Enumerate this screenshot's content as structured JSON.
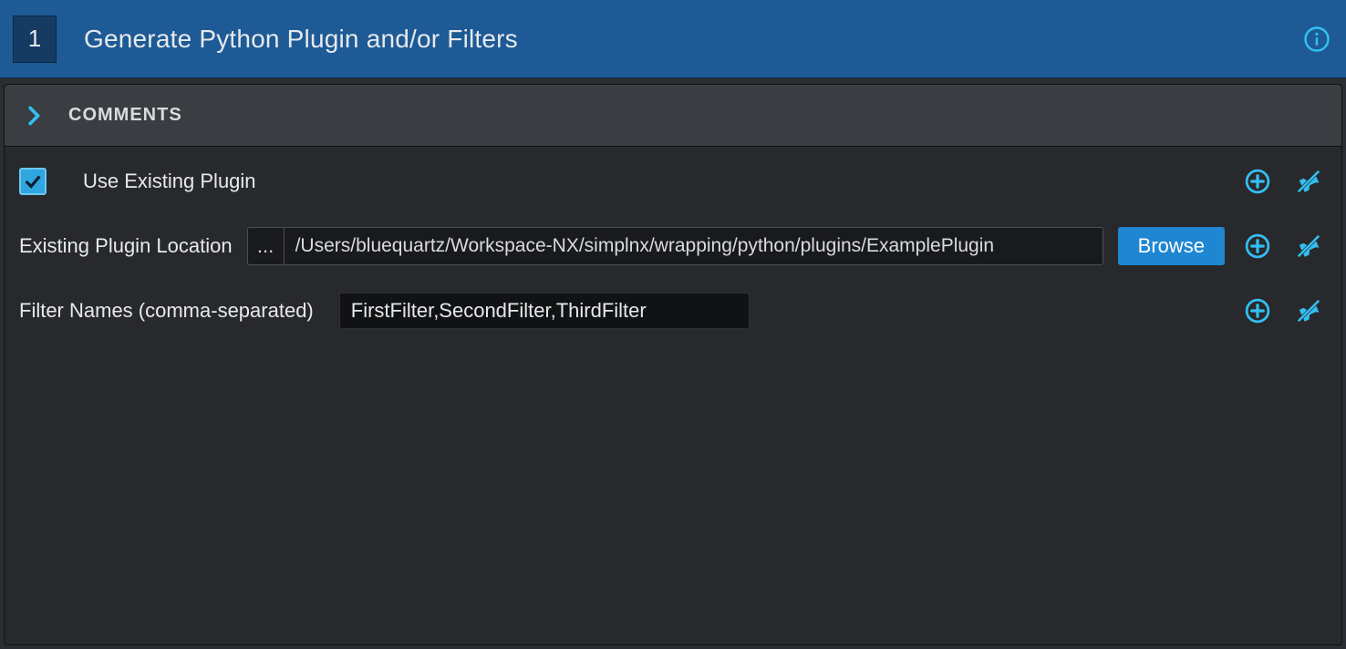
{
  "header": {
    "step_number": "1",
    "title": "Generate Python Plugin and/or Filters"
  },
  "comments": {
    "label": "COMMENTS"
  },
  "form": {
    "use_existing": {
      "label": "Use Existing Plugin",
      "checked": true
    },
    "plugin_location": {
      "label": "Existing Plugin Location",
      "ellipsis": "...",
      "value": "/Users/bluequartz/Workspace-NX/simplnx/wrapping/python/plugins/ExamplePlugin",
      "browse_label": "Browse"
    },
    "filter_names": {
      "label": "Filter Names (comma-separated)",
      "value": "FirstFilter,SecondFilter,ThirdFilter"
    }
  },
  "icons": {
    "info": "info-icon",
    "chevron": "chevron-right-icon",
    "add": "add-circle-icon",
    "unpin": "pin-off-icon"
  }
}
